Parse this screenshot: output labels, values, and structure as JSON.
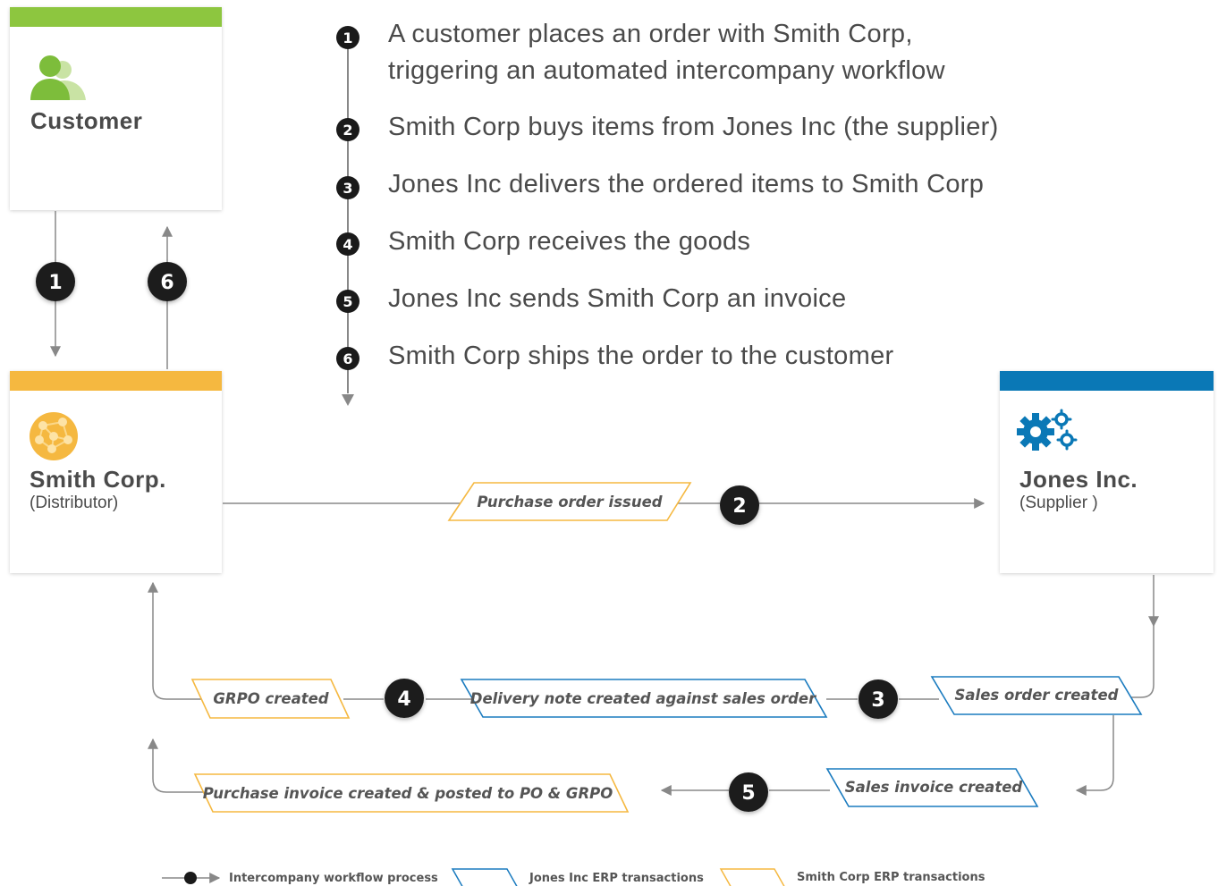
{
  "customer": {
    "title": "Customer",
    "bar_color": "#8dc63f"
  },
  "smith": {
    "title": "Smith Corp.",
    "subtitle": "(Distributor)",
    "bar_color": "#f5b840"
  },
  "jones": {
    "title": "Jones Inc.",
    "subtitle": "(Supplier )",
    "bar_color": "#0a78b6"
  },
  "steps": [
    {
      "num": "1",
      "text_line1": "A customer places an order with Smith Corp,",
      "text_line2": "triggering an automated intercompany workflow"
    },
    {
      "num": "2",
      "text": "Smith Corp buys items from Jones Inc (the supplier)"
    },
    {
      "num": "3",
      "text": "Jones Inc delivers the ordered items to Smith Corp"
    },
    {
      "num": "4",
      "text": "Smith Corp receives the goods"
    },
    {
      "num": "5",
      "text": "Jones Inc sends Smith Corp an invoice"
    },
    {
      "num": "6",
      "text": "Smith Corp ships the order to the customer"
    }
  ],
  "flow": {
    "badges": {
      "b1": "1",
      "b6": "6",
      "b2": "2",
      "b3": "3",
      "b4": "4",
      "b5": "5"
    },
    "purchase_order": "Purchase order issued",
    "grpo": "GRPO created",
    "delivery_note": "Delivery note created against sales order",
    "sales_order": "Sales order created",
    "sales_invoice": "Sales invoice created",
    "purchase_invoice": "Purchase invoice created & posted to PO & GRPO"
  },
  "legend": {
    "workflow": "Intercompany workflow process",
    "jones_erp": "Jones Inc ERP transactions",
    "smith_erp": "Smith Corp ERP transactions"
  },
  "colors": {
    "smith_outline": "#f5b840",
    "jones_outline": "#1a7bbf",
    "badge": "#1a1a1a",
    "line": "#888888"
  },
  "icons": {
    "customer": "people-icon",
    "smith": "network-ball-icon",
    "jones": "gears-icon"
  }
}
